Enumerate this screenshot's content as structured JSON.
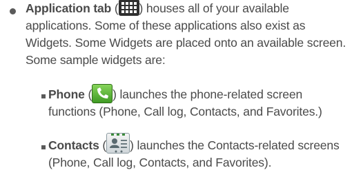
{
  "item1": {
    "title": "Application tab",
    "open_paren": " (",
    "after_icon": ") houses all of your available applications. Some of these applications also exist as Widgets. Some Widgets are placed onto an available screen. Some sample widgets are:",
    "icon": "app-grid-icon"
  },
  "item2": {
    "title": "Phone",
    "open_paren": " (",
    "after_icon": ") launches the phone-related screen functions (Phone, Call log, Contacts, and Favorites.)",
    "icon": "phone-handset-icon",
    "icon_color": "#5cb83a"
  },
  "item3": {
    "title": "Contacts",
    "open_paren": " (",
    "after_icon": ") launches the Contacts-related screens (Phone, Call log, Contacts, and Favorites).",
    "icon": "contacts-card-icon"
  }
}
